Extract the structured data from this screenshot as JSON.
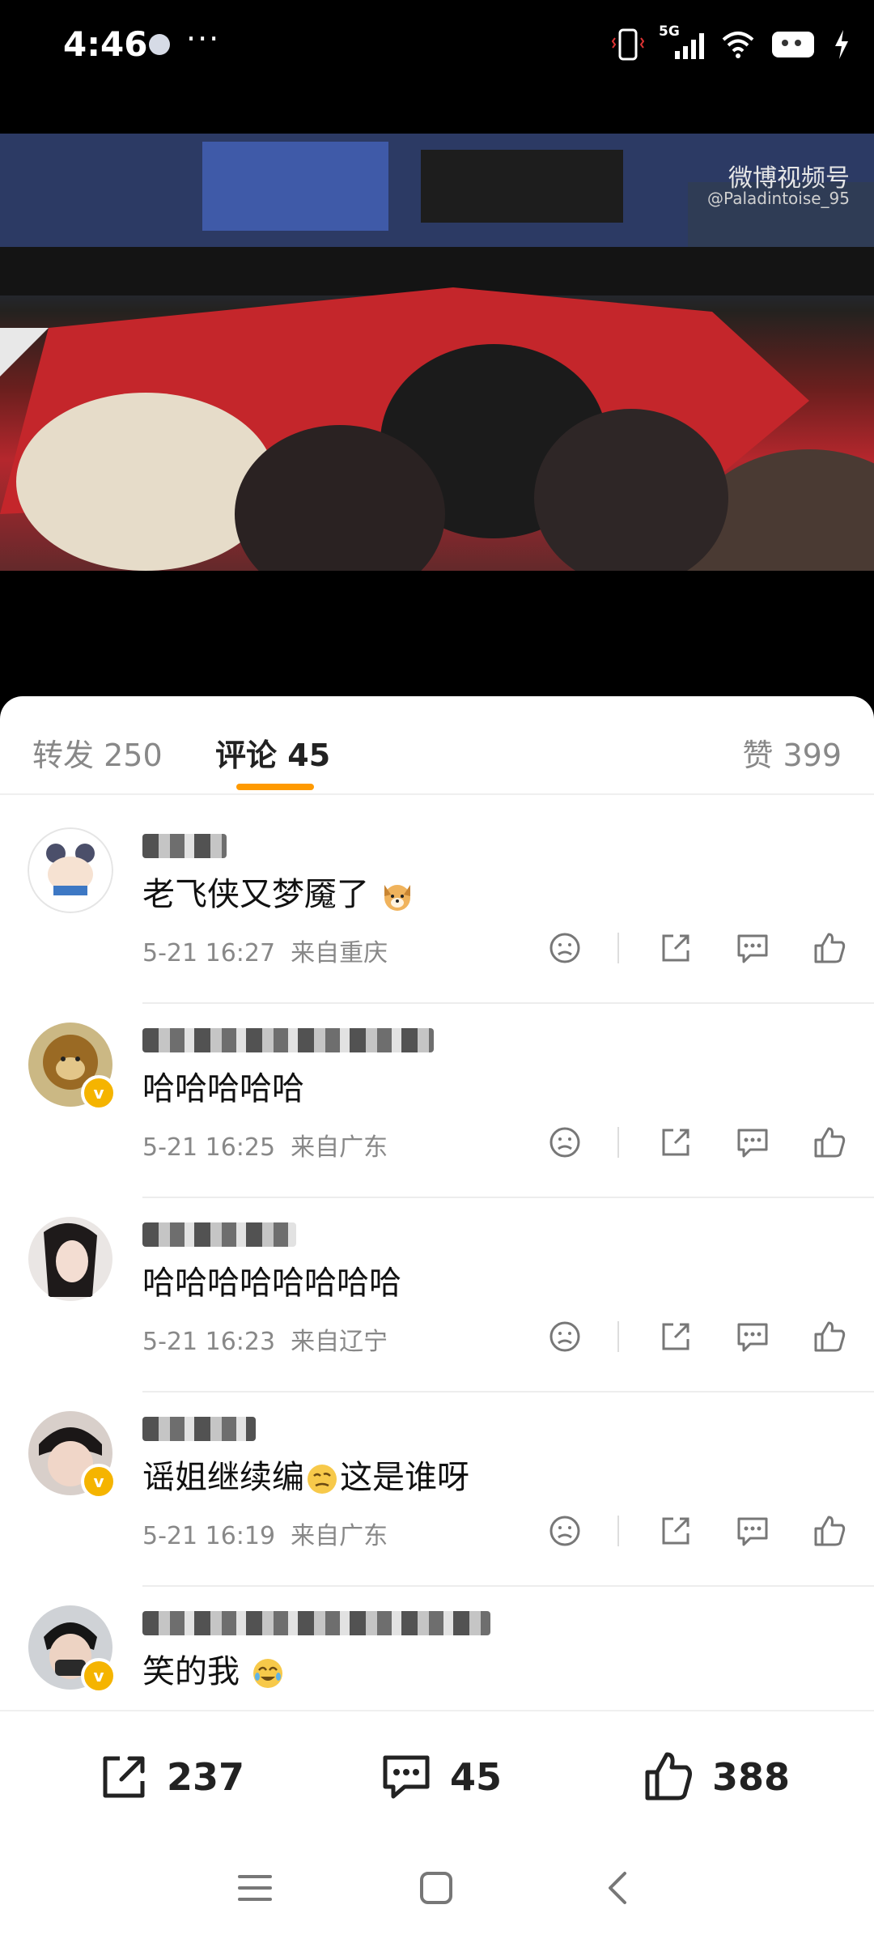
{
  "status_bar": {
    "time": "4:46",
    "overflow": "···",
    "network": "5G"
  },
  "video": {
    "watermark_title": "微博视频号",
    "watermark_handle": "@Paladintoise_95"
  },
  "tabs": [
    {
      "label": "转发",
      "count": "250",
      "active": false
    },
    {
      "label": "评论",
      "count": "45",
      "active": true
    },
    {
      "label": "赞",
      "count": "399",
      "active": false
    }
  ],
  "comments": [
    {
      "text": "老飞侠又梦魇了",
      "emoji": "dog-face-icon",
      "date": "5-21 16:27",
      "location": "来自重庆",
      "verified": false
    },
    {
      "text": "哈哈哈哈哈",
      "emoji": "",
      "date": "5-21 16:25",
      "location": "来自广东",
      "verified": true
    },
    {
      "text": "哈哈哈哈哈哈哈哈",
      "emoji": "",
      "date": "5-21 16:23",
      "location": "来自辽宁",
      "verified": false
    },
    {
      "text_before": "谣姐继续编",
      "text_after": "这是谁呀",
      "emoji": "thinking-face-icon",
      "date": "5-21 16:19",
      "location": "来自广东",
      "verified": true
    },
    {
      "text": "笑的我",
      "emoji": "crying-laughing-face-icon",
      "date": "",
      "location": "",
      "verified": true
    }
  ],
  "action_bar": {
    "repost_count": "237",
    "comment_count": "45",
    "like_count": "388"
  },
  "colors": {
    "accent": "#ff9a00",
    "verified": "#f5b400"
  }
}
